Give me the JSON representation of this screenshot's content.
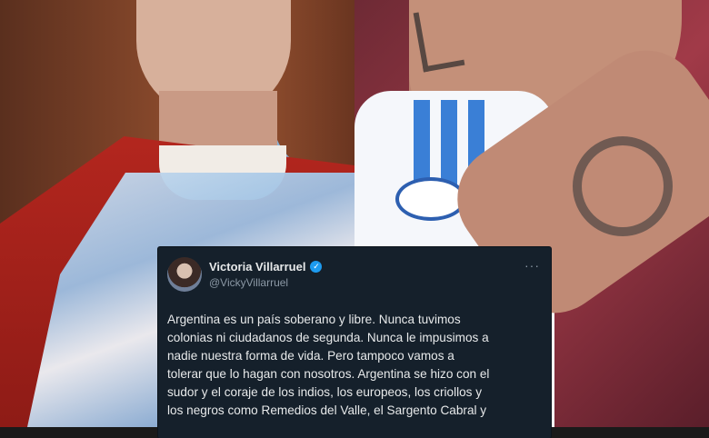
{
  "tweet": {
    "name": "Victoria Villarruel",
    "handle": "@VickyVillarruel",
    "more": "···",
    "verified": "✓",
    "lines": [
      "Argentina es un país soberano y libre. Nunca tuvimos",
      "colonias ni ciudadanos de segunda. Nunca le impusimos a",
      "nadie nuestra forma de vida. Pero tampoco vamos a",
      "tolerar que lo hagan con nosotros. Argentina se hizo con el",
      "sudor y el coraje de los indios, los europeos, los criollos y",
      "los negros como Remedios del Valle, el Sargento Cabral y"
    ]
  },
  "colors": {
    "tweet_bg": "#15202b",
    "verified": "#1d9bf0",
    "handle": "#8b98a5"
  }
}
